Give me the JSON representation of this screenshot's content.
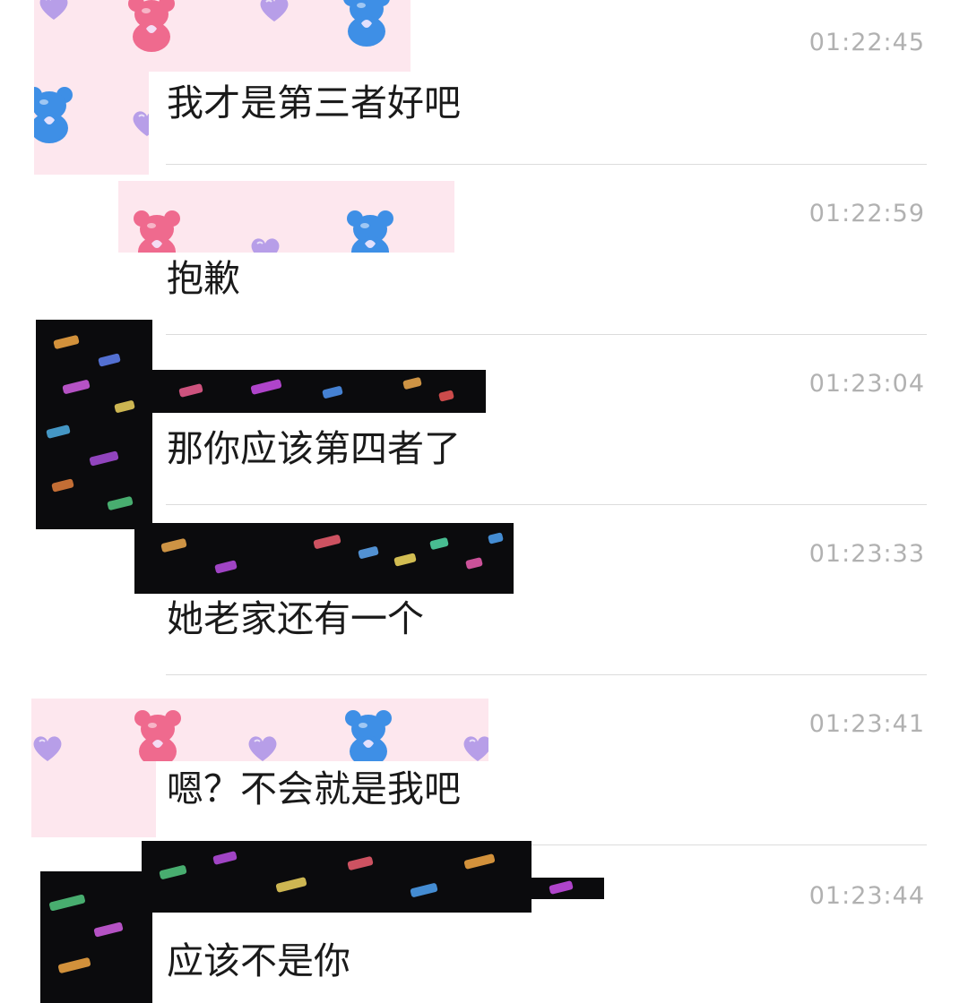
{
  "messages": [
    {
      "time": "01:22:45",
      "text": "我才是第三者好吧"
    },
    {
      "time": "01:22:59",
      "text": "抱歉"
    },
    {
      "time": "01:23:04",
      "text": "那你应该第四者了"
    },
    {
      "time": "01:23:33",
      "text": "她老家还有一个"
    },
    {
      "time": "01:23:41",
      "text": "嗯？不会就是我吧"
    },
    {
      "time": "01:23:44",
      "text": "应该不是你"
    }
  ],
  "colors": {
    "timestamp": "#b1b1b1",
    "message_text": "#1a1a1a",
    "divider": "#dcdcdc",
    "sticker_pink": "#fde7ee",
    "sticker_dark": "#0b0b0d",
    "bear_pink": "#ef6a8e",
    "bear_blue": "#3e8fe6",
    "heart_lilac": "#b79ee8"
  },
  "icons": [
    "bear-sticker-icon",
    "heart-sticker-icon",
    "confetti-sticker"
  ]
}
